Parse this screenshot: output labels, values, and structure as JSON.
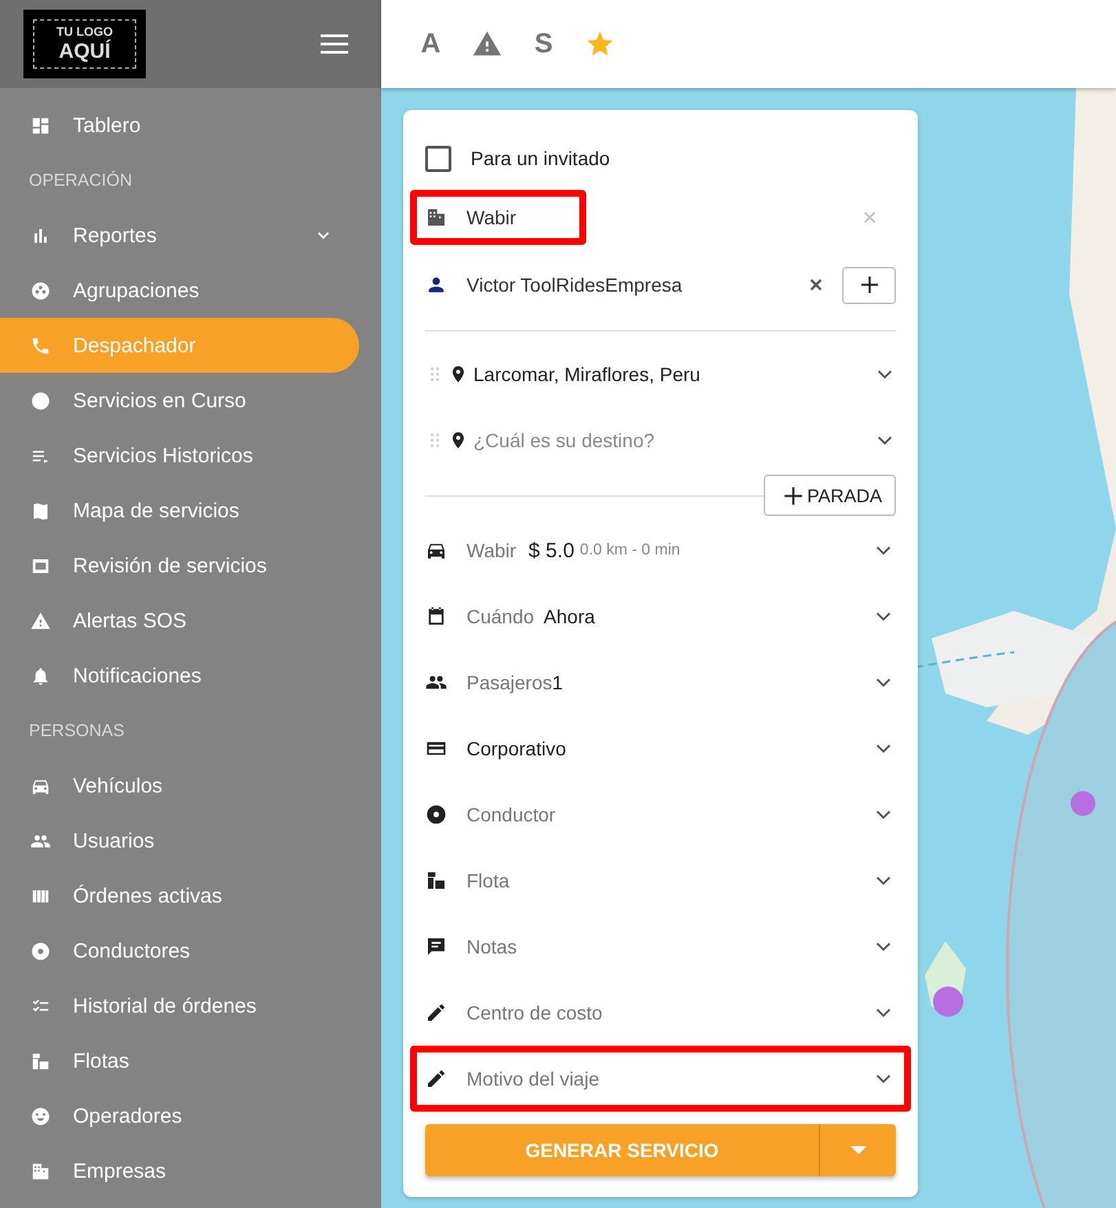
{
  "sidebar": {
    "logo": {
      "line_1": "TU LOGO",
      "line_2": "AQUÍ"
    },
    "items": [
      {
        "kind": "item",
        "label": "Tablero",
        "selected": false
      },
      {
        "kind": "section",
        "label": "OPERACIÓN"
      },
      {
        "kind": "group",
        "label": "Reportes",
        "selected": false
      },
      {
        "kind": "item",
        "label": "Agrupaciones",
        "selected": false
      },
      {
        "kind": "item",
        "label": "Despachador",
        "selected": true
      },
      {
        "kind": "item",
        "label": "Servicios en Curso",
        "selected": false
      },
      {
        "kind": "item",
        "label": "Servicios Historicos",
        "selected": false
      },
      {
        "kind": "item",
        "label": "Mapa de servicios",
        "selected": false
      },
      {
        "kind": "item",
        "label": "Revisión de servicios",
        "selected": false
      },
      {
        "kind": "item",
        "label": "Alertas SOS",
        "selected": false
      },
      {
        "kind": "item",
        "label": "Notificaciones",
        "selected": false
      },
      {
        "kind": "section",
        "label": "PERSONAS"
      },
      {
        "kind": "item",
        "label": "Vehículos",
        "selected": false
      },
      {
        "kind": "item",
        "label": "Usuarios",
        "selected": false
      },
      {
        "kind": "item",
        "label": "Órdenes activas",
        "selected": false
      },
      {
        "kind": "item",
        "label": "Conductores",
        "selected": false
      },
      {
        "kind": "item",
        "label": "Historial de órdenes",
        "selected": false
      },
      {
        "kind": "item",
        "label": "Flotas",
        "selected": false
      },
      {
        "kind": "item",
        "label": "Operadores",
        "selected": false
      },
      {
        "kind": "item",
        "label": "Empresas",
        "selected": false
      }
    ]
  },
  "toolbar": {
    "items": [
      {
        "kind": "letter",
        "label": "A"
      },
      {
        "kind": "warning"
      },
      {
        "kind": "letter",
        "label": "S"
      },
      {
        "kind": "star"
      }
    ]
  },
  "form": {
    "guest": {
      "label": "Para un invitado",
      "checked": false
    },
    "company": {
      "value": "Wabir",
      "highlighted": true
    },
    "passenger": {
      "value": "Victor ToolRidesEmpresa"
    },
    "stops": [
      {
        "value": "Larcomar, Miraflores, Peru"
      },
      {
        "placeholder": "¿Cuál es su destino?"
      }
    ],
    "add_stop": "PARADA",
    "options": [
      {
        "kind": "vehicle",
        "label": "Wabir",
        "value": "$ 5.0",
        "detail": "0.0 km - 0 min",
        "highlighted": false
      },
      {
        "kind": "when",
        "label": "Cuándo",
        "value": "Ahora",
        "highlighted": false
      },
      {
        "kind": "passengers",
        "label": "Pasajeros",
        "value": "1",
        "highlighted": false
      },
      {
        "kind": "payment",
        "value": "Corporativo",
        "highlighted": false
      },
      {
        "kind": "driver",
        "label": "Conductor",
        "highlighted": false
      },
      {
        "kind": "fleet",
        "label": "Flota",
        "highlighted": false
      },
      {
        "kind": "notes",
        "label": "Notas",
        "highlighted": false
      },
      {
        "kind": "cost",
        "label": "Centro de costo",
        "highlighted": false
      },
      {
        "kind": "reason",
        "label": "Motivo del viaje",
        "highlighted": true
      }
    ],
    "submit": "GENERAR SERVICIO"
  }
}
